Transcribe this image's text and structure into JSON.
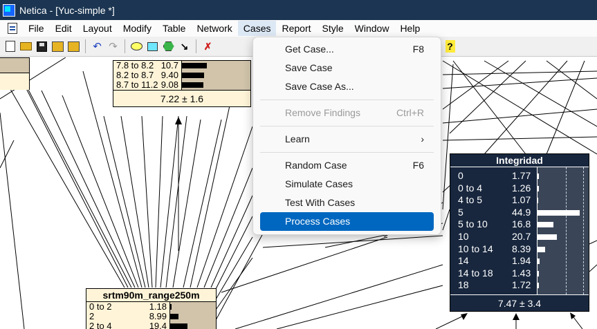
{
  "window": {
    "title": "Netica - [Yuc-simple *]"
  },
  "menubar": {
    "items": [
      {
        "label": "File"
      },
      {
        "label": "Edit"
      },
      {
        "label": "Layout"
      },
      {
        "label": "Modify"
      },
      {
        "label": "Table"
      },
      {
        "label": "Network"
      },
      {
        "label": "Cases"
      },
      {
        "label": "Report"
      },
      {
        "label": "Style"
      },
      {
        "label": "Window"
      },
      {
        "label": "Help"
      }
    ],
    "active": "Cases"
  },
  "toolbar": {
    "icons": [
      "new-network-icon",
      "open-icon",
      "save-icon",
      "save-multiple-icon",
      "library-icon",
      "undo-icon",
      "redo-icon",
      "ellipse-node-icon",
      "rect-node-icon",
      "hexagon-node-icon",
      "arrow-link-icon",
      "remove-icon",
      "star-icon",
      "info-icon",
      "help-icon"
    ]
  },
  "cases_menu": {
    "items": [
      {
        "label": "Get Case...",
        "shortcut": "F8",
        "enabled": true
      },
      {
        "label": "Save Case",
        "shortcut": "",
        "enabled": true
      },
      {
        "label": "Save Case As...",
        "shortcut": "",
        "enabled": true
      },
      {
        "separator": true
      },
      {
        "label": "Remove Findings",
        "shortcut": "Ctrl+R",
        "enabled": false
      },
      {
        "separator": true
      },
      {
        "label": "Learn",
        "shortcut": "›",
        "enabled": true
      },
      {
        "separator": true
      },
      {
        "label": "Random Case",
        "shortcut": "F6",
        "enabled": true
      },
      {
        "label": "Simulate Cases",
        "shortcut": "",
        "enabled": true
      },
      {
        "label": "Test With Cases",
        "shortcut": "",
        "enabled": true
      },
      {
        "label": "Process Cases",
        "shortcut": "",
        "enabled": true,
        "highlighted": true
      }
    ]
  },
  "nodes": {
    "top_node": {
      "states": [
        {
          "name": "7.8 to 8.2",
          "value": "10.7",
          "pct": 10.7
        },
        {
          "name": "8.2 to 8.7",
          "value": "9.40",
          "pct": 9.4
        },
        {
          "name": "8.7 to 11.2",
          "value": "9.08",
          "pct": 9.08
        }
      ],
      "footer": "7.22 ± 1.6"
    },
    "srtm": {
      "title": "srtm90m_range250m",
      "states": [
        {
          "name": "0 to 2",
          "value": "1.18",
          "pct": 1.18
        },
        {
          "name": "2",
          "value": "8.99",
          "pct": 8.99
        },
        {
          "name": "2 to 4",
          "value": "19.4",
          "pct": 19.4
        }
      ]
    },
    "integridad": {
      "title": "Integridad",
      "states": [
        {
          "name": "0",
          "value": "1.77",
          "pct": 1.77
        },
        {
          "name": "0 to 4",
          "value": "1.26",
          "pct": 1.26
        },
        {
          "name": "4 to 5",
          "value": "1.07",
          "pct": 1.07
        },
        {
          "name": "5",
          "value": "44.9",
          "pct": 44.9
        },
        {
          "name": "5 to 10",
          "value": "16.8",
          "pct": 16.8
        },
        {
          "name": "10",
          "value": "20.7",
          "pct": 20.7
        },
        {
          "name": "10 to 14",
          "value": "8.39",
          "pct": 8.39
        },
        {
          "name": "14",
          "value": "1.94",
          "pct": 1.94
        },
        {
          "name": "14 to 18",
          "value": "1.43",
          "pct": 1.43
        },
        {
          "name": "18",
          "value": "1.72",
          "pct": 1.72
        }
      ],
      "footer": "7.47 ± 3.4"
    }
  }
}
